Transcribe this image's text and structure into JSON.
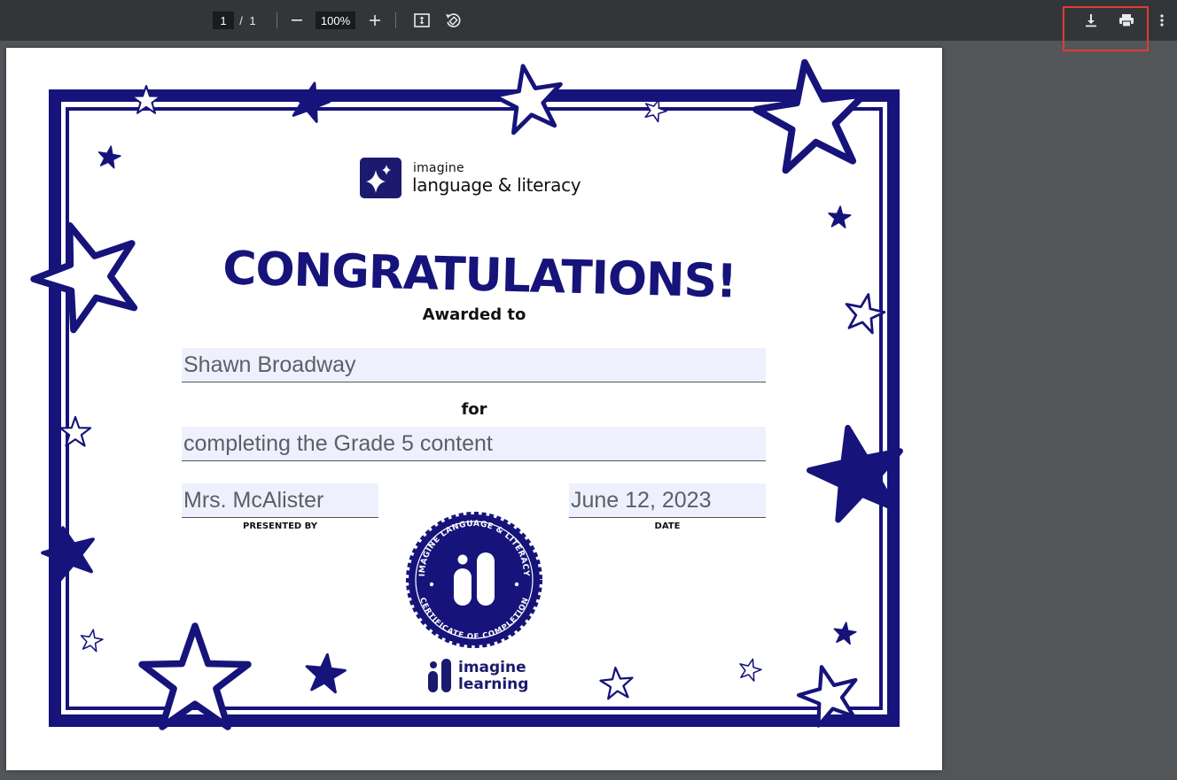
{
  "toolbar": {
    "page_current": "1",
    "page_separator": "/",
    "page_total": "1",
    "zoom": "100%"
  },
  "certificate": {
    "logo_small": "imagine",
    "logo_big": "language & literacy",
    "headline": "CONGRATULATIONS!",
    "awarded_to_label": "Awarded to",
    "recipient_name": "Shawn Broadway",
    "for_label": "for",
    "reason": "completing the Grade 5 content",
    "presenter": "Mrs. McAlister",
    "presented_by_label": "PRESENTED BY",
    "date": "June 12, 2023",
    "date_label": "DATE",
    "seal_top_text": "IMAGINE LANGUAGE & LITERACY",
    "seal_bottom_text": "CERTIFICATE OF COMPLETION",
    "footer_logo_line1": "imagine",
    "footer_logo_line2": "learning"
  },
  "colors": {
    "brand_navy": "#16147a",
    "toolbar_bg": "#323639",
    "viewer_bg": "#525659",
    "field_bg": "#eef1fd",
    "highlight_red": "#e53935"
  },
  "icons": {
    "zoom_out": "minus-icon",
    "zoom_in": "plus-icon",
    "fit": "fit-to-page-icon",
    "rotate": "rotate-icon",
    "download": "download-icon",
    "print": "print-icon",
    "more": "more-vert-icon"
  }
}
